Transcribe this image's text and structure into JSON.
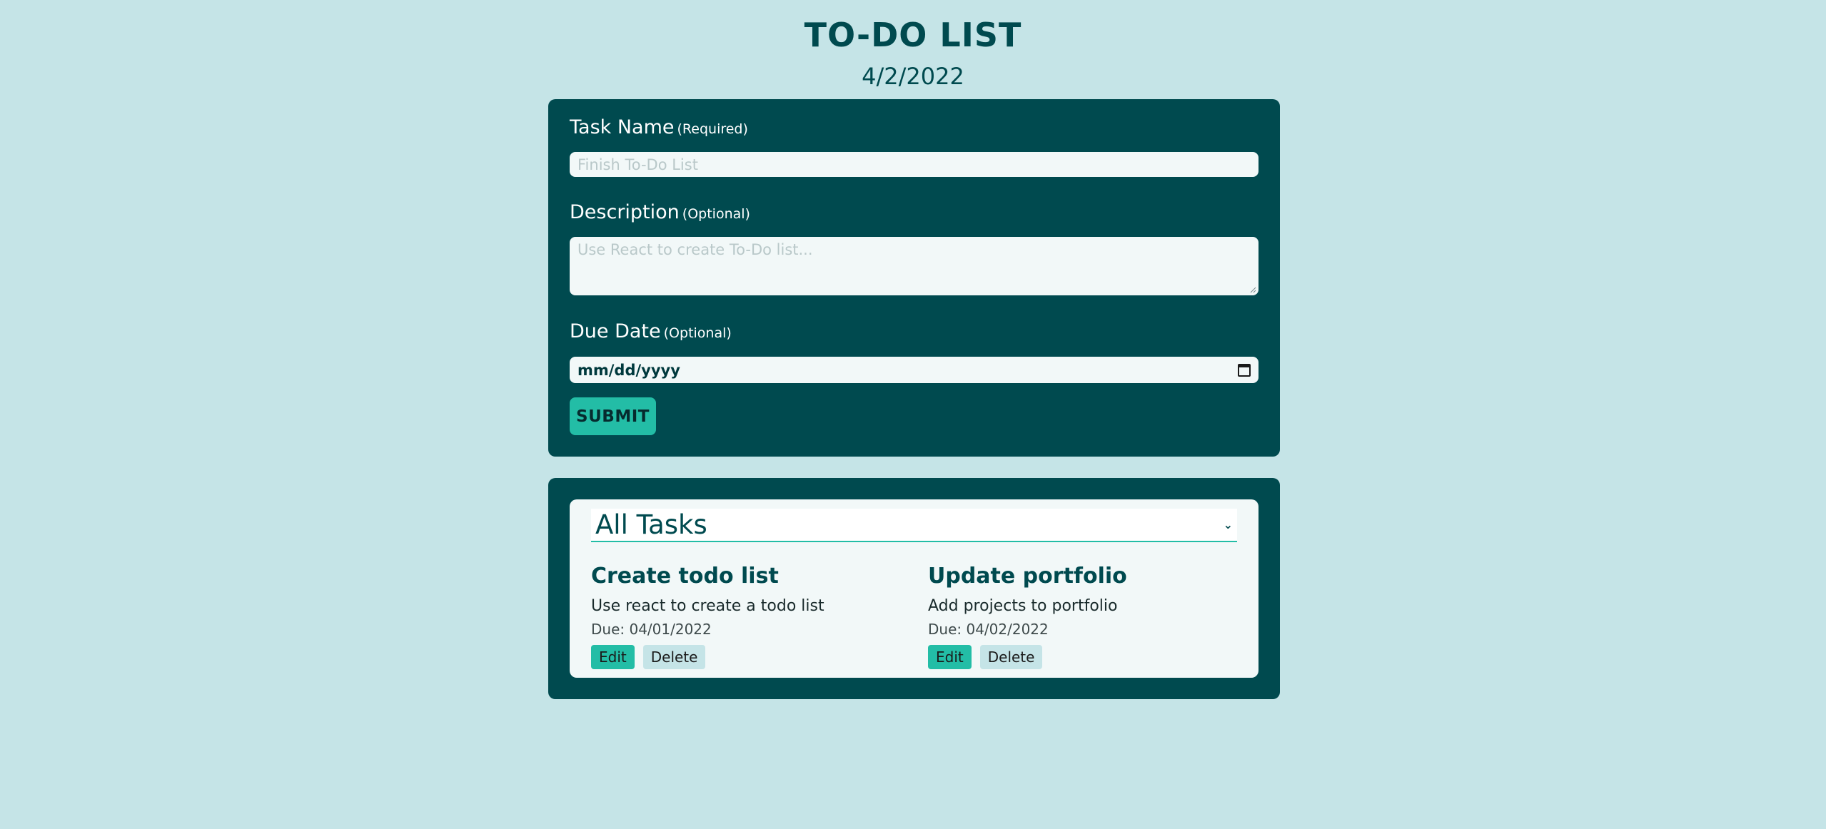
{
  "header": {
    "title": "TO-DO LIST",
    "date": "4/2/2022"
  },
  "form": {
    "task_name_label": "Task Name",
    "task_name_hint": "(Required)",
    "task_name_placeholder": "Finish To-Do List",
    "description_label": "Description",
    "description_hint": "(Optional)",
    "description_placeholder": "Use React to create To-Do list...",
    "due_date_label": "Due Date",
    "due_date_hint": "(Optional)",
    "due_date_value": "mm/dd/yyyy",
    "submit_label": "SUBMIT"
  },
  "filter": {
    "selected": "All Tasks"
  },
  "tasks": [
    {
      "title": "Create todo list",
      "description": "Use react to create a todo list",
      "due": "Due: 04/01/2022",
      "edit_label": "Edit",
      "delete_label": "Delete"
    },
    {
      "title": "Update portfolio",
      "description": "Add projects to portfolio",
      "due": "Due: 04/02/2022",
      "edit_label": "Edit",
      "delete_label": "Delete"
    }
  ],
  "icons": {
    "calendar": "calendar-icon",
    "chevron": "chevron-down-icon",
    "resize": "resize-grip-icon"
  },
  "colors": {
    "background": "#c5e4e7",
    "panel": "#004a4f",
    "accent": "#23bda6",
    "field": "#f2f8f8"
  }
}
